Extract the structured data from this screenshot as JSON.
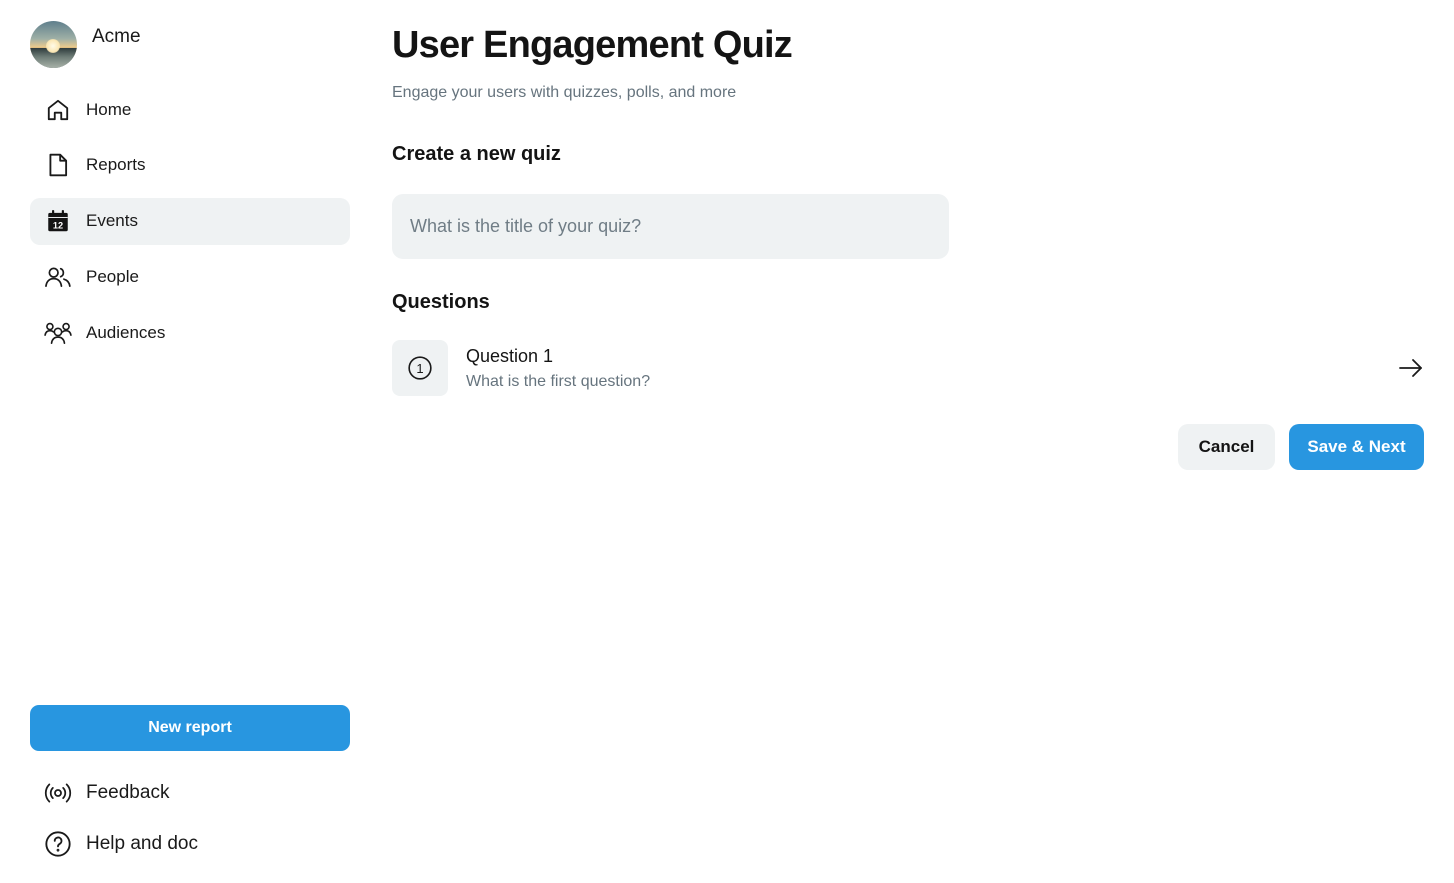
{
  "brand": {
    "name": "Acme"
  },
  "sidebar": {
    "items": [
      {
        "label": "Home",
        "icon": "home-icon",
        "active": false
      },
      {
        "label": "Reports",
        "icon": "document-icon",
        "active": false
      },
      {
        "label": "Events",
        "icon": "calendar-icon",
        "active": true,
        "icon_text": "12"
      },
      {
        "label": "People",
        "icon": "people-icon",
        "active": false
      },
      {
        "label": "Audiences",
        "icon": "audiences-icon",
        "active": false
      }
    ],
    "new_report_label": "New report",
    "feedback_label": "Feedback",
    "help_label": "Help and doc"
  },
  "main": {
    "title": "User Engagement Quiz",
    "subtitle": "Engage your users with quizzes, polls, and more",
    "create_heading": "Create a new quiz",
    "quiz_title_placeholder": "What is the title of your quiz?",
    "questions_heading": "Questions",
    "questions": [
      {
        "number": "1",
        "title": "Question 1",
        "description": "What is the first question?"
      }
    ],
    "cancel_label": "Cancel",
    "save_label": "Save & Next"
  },
  "colors": {
    "accent": "#2896e0",
    "surface": "#eff2f3",
    "muted_text": "#66747e",
    "text": "#141414"
  }
}
